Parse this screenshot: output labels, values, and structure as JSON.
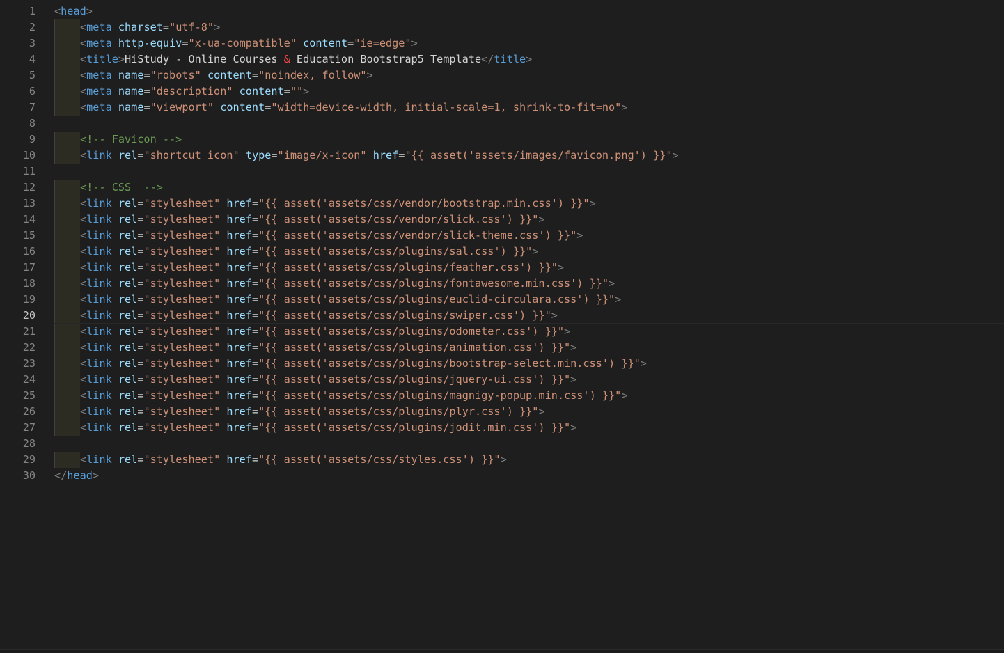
{
  "editor": {
    "active_line": 20,
    "lines": [
      {
        "n": "1",
        "indent": 0,
        "tokens": [
          [
            "p",
            "<"
          ],
          [
            "t",
            "head"
          ],
          [
            "p",
            ">"
          ]
        ]
      },
      {
        "n": "2",
        "indent": 1,
        "tokens": [
          [
            "p",
            "<"
          ],
          [
            "t",
            "meta"
          ],
          [
            "e",
            " "
          ],
          [
            "a",
            "charset"
          ],
          [
            "e",
            "="
          ],
          [
            "s",
            "\"utf-8\""
          ],
          [
            "p",
            ">"
          ]
        ]
      },
      {
        "n": "3",
        "indent": 1,
        "tokens": [
          [
            "p",
            "<"
          ],
          [
            "t",
            "meta"
          ],
          [
            "e",
            " "
          ],
          [
            "a",
            "http-equiv"
          ],
          [
            "e",
            "="
          ],
          [
            "s",
            "\"x-ua-compatible\""
          ],
          [
            "e",
            " "
          ],
          [
            "a",
            "content"
          ],
          [
            "e",
            "="
          ],
          [
            "s",
            "\"ie=edge\""
          ],
          [
            "p",
            ">"
          ]
        ]
      },
      {
        "n": "4",
        "indent": 1,
        "tokens": [
          [
            "p",
            "<"
          ],
          [
            "t",
            "title"
          ],
          [
            "p",
            ">"
          ],
          [
            "e",
            "HiStudy - Online Courses "
          ],
          [
            "amp",
            "&"
          ],
          [
            "e",
            " Education Bootstrap5 Template"
          ],
          [
            "p",
            "</"
          ],
          [
            "t",
            "title"
          ],
          [
            "p",
            ">"
          ]
        ]
      },
      {
        "n": "5",
        "indent": 1,
        "tokens": [
          [
            "p",
            "<"
          ],
          [
            "t",
            "meta"
          ],
          [
            "e",
            " "
          ],
          [
            "a",
            "name"
          ],
          [
            "e",
            "="
          ],
          [
            "s",
            "\"robots\""
          ],
          [
            "e",
            " "
          ],
          [
            "a",
            "content"
          ],
          [
            "e",
            "="
          ],
          [
            "s",
            "\"noindex, follow\""
          ],
          [
            "p",
            ">"
          ]
        ]
      },
      {
        "n": "6",
        "indent": 1,
        "tokens": [
          [
            "p",
            "<"
          ],
          [
            "t",
            "meta"
          ],
          [
            "e",
            " "
          ],
          [
            "a",
            "name"
          ],
          [
            "e",
            "="
          ],
          [
            "s",
            "\"description\""
          ],
          [
            "e",
            " "
          ],
          [
            "a",
            "content"
          ],
          [
            "e",
            "="
          ],
          [
            "s",
            "\"\""
          ],
          [
            "p",
            ">"
          ]
        ]
      },
      {
        "n": "7",
        "indent": 1,
        "tokens": [
          [
            "p",
            "<"
          ],
          [
            "t",
            "meta"
          ],
          [
            "e",
            " "
          ],
          [
            "a",
            "name"
          ],
          [
            "e",
            "="
          ],
          [
            "s",
            "\"viewport\""
          ],
          [
            "e",
            " "
          ],
          [
            "a",
            "content"
          ],
          [
            "e",
            "="
          ],
          [
            "s",
            "\"width=device-width, initial-scale=1, shrink-to-fit=no\""
          ],
          [
            "p",
            ">"
          ]
        ]
      },
      {
        "n": "8",
        "indent": 0,
        "tokens": []
      },
      {
        "n": "9",
        "indent": 1,
        "tokens": [
          [
            "c",
            "<!-- Favicon -->"
          ]
        ]
      },
      {
        "n": "10",
        "indent": 1,
        "tokens": [
          [
            "p",
            "<"
          ],
          [
            "t",
            "link"
          ],
          [
            "e",
            " "
          ],
          [
            "a",
            "rel"
          ],
          [
            "e",
            "="
          ],
          [
            "s",
            "\"shortcut icon\""
          ],
          [
            "e",
            " "
          ],
          [
            "a",
            "type"
          ],
          [
            "e",
            "="
          ],
          [
            "s",
            "\"image/x-icon\""
          ],
          [
            "e",
            " "
          ],
          [
            "a",
            "href"
          ],
          [
            "e",
            "="
          ],
          [
            "s",
            "\"{{ asset('assets/images/favicon.png') }}\""
          ],
          [
            "p",
            ">"
          ]
        ]
      },
      {
        "n": "11",
        "indent": 0,
        "tokens": []
      },
      {
        "n": "12",
        "indent": 1,
        "tokens": [
          [
            "c",
            "<!-- CSS  -->"
          ]
        ]
      },
      {
        "n": "13",
        "indent": 1,
        "tokens": [
          [
            "p",
            "<"
          ],
          [
            "t",
            "link"
          ],
          [
            "e",
            " "
          ],
          [
            "a",
            "rel"
          ],
          [
            "e",
            "="
          ],
          [
            "s",
            "\"stylesheet\""
          ],
          [
            "e",
            " "
          ],
          [
            "a",
            "href"
          ],
          [
            "e",
            "="
          ],
          [
            "s",
            "\"{{ asset('assets/css/vendor/bootstrap.min.css') }}\""
          ],
          [
            "p",
            ">"
          ]
        ]
      },
      {
        "n": "14",
        "indent": 1,
        "tokens": [
          [
            "p",
            "<"
          ],
          [
            "t",
            "link"
          ],
          [
            "e",
            " "
          ],
          [
            "a",
            "rel"
          ],
          [
            "e",
            "="
          ],
          [
            "s",
            "\"stylesheet\""
          ],
          [
            "e",
            " "
          ],
          [
            "a",
            "href"
          ],
          [
            "e",
            "="
          ],
          [
            "s",
            "\"{{ asset('assets/css/vendor/slick.css') }}\""
          ],
          [
            "p",
            ">"
          ]
        ]
      },
      {
        "n": "15",
        "indent": 1,
        "tokens": [
          [
            "p",
            "<"
          ],
          [
            "t",
            "link"
          ],
          [
            "e",
            " "
          ],
          [
            "a",
            "rel"
          ],
          [
            "e",
            "="
          ],
          [
            "s",
            "\"stylesheet\""
          ],
          [
            "e",
            " "
          ],
          [
            "a",
            "href"
          ],
          [
            "e",
            "="
          ],
          [
            "s",
            "\"{{ asset('assets/css/vendor/slick-theme.css') }}\""
          ],
          [
            "p",
            ">"
          ]
        ]
      },
      {
        "n": "16",
        "indent": 1,
        "tokens": [
          [
            "p",
            "<"
          ],
          [
            "t",
            "link"
          ],
          [
            "e",
            " "
          ],
          [
            "a",
            "rel"
          ],
          [
            "e",
            "="
          ],
          [
            "s",
            "\"stylesheet\""
          ],
          [
            "e",
            " "
          ],
          [
            "a",
            "href"
          ],
          [
            "e",
            "="
          ],
          [
            "s",
            "\"{{ asset('assets/css/plugins/sal.css') }}\""
          ],
          [
            "p",
            ">"
          ]
        ]
      },
      {
        "n": "17",
        "indent": 1,
        "tokens": [
          [
            "p",
            "<"
          ],
          [
            "t",
            "link"
          ],
          [
            "e",
            " "
          ],
          [
            "a",
            "rel"
          ],
          [
            "e",
            "="
          ],
          [
            "s",
            "\"stylesheet\""
          ],
          [
            "e",
            " "
          ],
          [
            "a",
            "href"
          ],
          [
            "e",
            "="
          ],
          [
            "s",
            "\"{{ asset('assets/css/plugins/feather.css') }}\""
          ],
          [
            "p",
            ">"
          ]
        ]
      },
      {
        "n": "18",
        "indent": 1,
        "tokens": [
          [
            "p",
            "<"
          ],
          [
            "t",
            "link"
          ],
          [
            "e",
            " "
          ],
          [
            "a",
            "rel"
          ],
          [
            "e",
            "="
          ],
          [
            "s",
            "\"stylesheet\""
          ],
          [
            "e",
            " "
          ],
          [
            "a",
            "href"
          ],
          [
            "e",
            "="
          ],
          [
            "s",
            "\"{{ asset('assets/css/plugins/fontawesome.min.css') }}\""
          ],
          [
            "p",
            ">"
          ]
        ]
      },
      {
        "n": "19",
        "indent": 1,
        "tokens": [
          [
            "p",
            "<"
          ],
          [
            "t",
            "link"
          ],
          [
            "e",
            " "
          ],
          [
            "a",
            "rel"
          ],
          [
            "e",
            "="
          ],
          [
            "s",
            "\"stylesheet\""
          ],
          [
            "e",
            " "
          ],
          [
            "a",
            "href"
          ],
          [
            "e",
            "="
          ],
          [
            "s",
            "\"{{ asset('assets/css/plugins/euclid-circulara.css') }}\""
          ],
          [
            "p",
            ">"
          ]
        ]
      },
      {
        "n": "20",
        "indent": 1,
        "tokens": [
          [
            "p",
            "<"
          ],
          [
            "t",
            "link"
          ],
          [
            "e",
            " "
          ],
          [
            "a",
            "rel"
          ],
          [
            "e",
            "="
          ],
          [
            "s",
            "\"stylesheet\""
          ],
          [
            "e",
            " "
          ],
          [
            "a",
            "href"
          ],
          [
            "e",
            "="
          ],
          [
            "s",
            "\"{{ asset('assets/css/plugins/swiper.css') }}\""
          ],
          [
            "p",
            ">"
          ]
        ]
      },
      {
        "n": "21",
        "indent": 1,
        "tokens": [
          [
            "p",
            "<"
          ],
          [
            "t",
            "link"
          ],
          [
            "e",
            " "
          ],
          [
            "a",
            "rel"
          ],
          [
            "e",
            "="
          ],
          [
            "s",
            "\"stylesheet\""
          ],
          [
            "e",
            " "
          ],
          [
            "a",
            "href"
          ],
          [
            "e",
            "="
          ],
          [
            "s",
            "\"{{ asset('assets/css/plugins/odometer.css') }}\""
          ],
          [
            "p",
            ">"
          ]
        ]
      },
      {
        "n": "22",
        "indent": 1,
        "tokens": [
          [
            "p",
            "<"
          ],
          [
            "t",
            "link"
          ],
          [
            "e",
            " "
          ],
          [
            "a",
            "rel"
          ],
          [
            "e",
            "="
          ],
          [
            "s",
            "\"stylesheet\""
          ],
          [
            "e",
            " "
          ],
          [
            "a",
            "href"
          ],
          [
            "e",
            "="
          ],
          [
            "s",
            "\"{{ asset('assets/css/plugins/animation.css') }}\""
          ],
          [
            "p",
            ">"
          ]
        ]
      },
      {
        "n": "23",
        "indent": 1,
        "tokens": [
          [
            "p",
            "<"
          ],
          [
            "t",
            "link"
          ],
          [
            "e",
            " "
          ],
          [
            "a",
            "rel"
          ],
          [
            "e",
            "="
          ],
          [
            "s",
            "\"stylesheet\""
          ],
          [
            "e",
            " "
          ],
          [
            "a",
            "href"
          ],
          [
            "e",
            "="
          ],
          [
            "s",
            "\"{{ asset('assets/css/plugins/bootstrap-select.min.css') }}\""
          ],
          [
            "p",
            ">"
          ]
        ]
      },
      {
        "n": "24",
        "indent": 1,
        "tokens": [
          [
            "p",
            "<"
          ],
          [
            "t",
            "link"
          ],
          [
            "e",
            " "
          ],
          [
            "a",
            "rel"
          ],
          [
            "e",
            "="
          ],
          [
            "s",
            "\"stylesheet\""
          ],
          [
            "e",
            " "
          ],
          [
            "a",
            "href"
          ],
          [
            "e",
            "="
          ],
          [
            "s",
            "\"{{ asset('assets/css/plugins/jquery-ui.css') }}\""
          ],
          [
            "p",
            ">"
          ]
        ]
      },
      {
        "n": "25",
        "indent": 1,
        "tokens": [
          [
            "p",
            "<"
          ],
          [
            "t",
            "link"
          ],
          [
            "e",
            " "
          ],
          [
            "a",
            "rel"
          ],
          [
            "e",
            "="
          ],
          [
            "s",
            "\"stylesheet\""
          ],
          [
            "e",
            " "
          ],
          [
            "a",
            "href"
          ],
          [
            "e",
            "="
          ],
          [
            "s",
            "\"{{ asset('assets/css/plugins/magnigy-popup.min.css') }}\""
          ],
          [
            "p",
            ">"
          ]
        ]
      },
      {
        "n": "26",
        "indent": 1,
        "tokens": [
          [
            "p",
            "<"
          ],
          [
            "t",
            "link"
          ],
          [
            "e",
            " "
          ],
          [
            "a",
            "rel"
          ],
          [
            "e",
            "="
          ],
          [
            "s",
            "\"stylesheet\""
          ],
          [
            "e",
            " "
          ],
          [
            "a",
            "href"
          ],
          [
            "e",
            "="
          ],
          [
            "s",
            "\"{{ asset('assets/css/plugins/plyr.css') }}\""
          ],
          [
            "p",
            ">"
          ]
        ]
      },
      {
        "n": "27",
        "indent": 1,
        "tokens": [
          [
            "p",
            "<"
          ],
          [
            "t",
            "link"
          ],
          [
            "e",
            " "
          ],
          [
            "a",
            "rel"
          ],
          [
            "e",
            "="
          ],
          [
            "s",
            "\"stylesheet\""
          ],
          [
            "e",
            " "
          ],
          [
            "a",
            "href"
          ],
          [
            "e",
            "="
          ],
          [
            "s",
            "\"{{ asset('assets/css/plugins/jodit.min.css') }}\""
          ],
          [
            "p",
            ">"
          ]
        ]
      },
      {
        "n": "28",
        "indent": 0,
        "tokens": []
      },
      {
        "n": "29",
        "indent": 1,
        "tokens": [
          [
            "p",
            "<"
          ],
          [
            "t",
            "link"
          ],
          [
            "e",
            " "
          ],
          [
            "a",
            "rel"
          ],
          [
            "e",
            "="
          ],
          [
            "s",
            "\"stylesheet\""
          ],
          [
            "e",
            " "
          ],
          [
            "a",
            "href"
          ],
          [
            "e",
            "="
          ],
          [
            "s",
            "\"{{ asset('assets/css/styles.css') }}\""
          ],
          [
            "p",
            ">"
          ]
        ]
      },
      {
        "n": "30",
        "indent": 0,
        "tokens": [
          [
            "p",
            "</"
          ],
          [
            "t",
            "head"
          ],
          [
            "p",
            ">"
          ]
        ]
      }
    ]
  }
}
